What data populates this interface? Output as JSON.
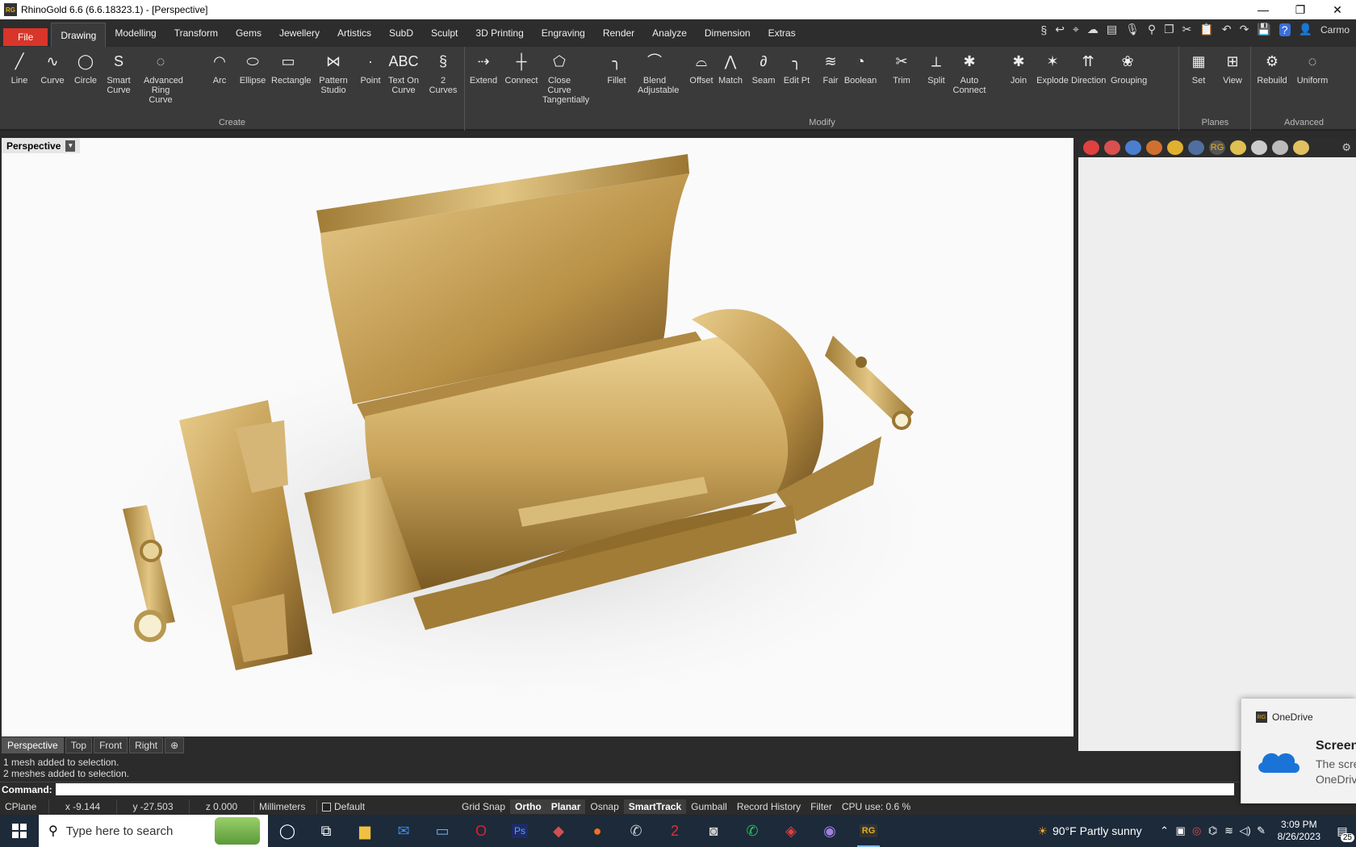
{
  "window": {
    "title": "RhinoGold 6.6 (6.6.18323.1) - [Perspective]",
    "logo": "RG",
    "min": "—",
    "max": "❐",
    "close": "✕"
  },
  "menu": [
    "File",
    "Drawing",
    "Modelling",
    "Transform",
    "Gems",
    "Jewellery",
    "Artistics",
    "SubD",
    "Sculpt",
    "3D Printing",
    "Engraving",
    "Render",
    "Analyze",
    "Dimension",
    "Extras"
  ],
  "quick": {
    "user": "Carmo"
  },
  "ribbon": {
    "create": {
      "label": "Create",
      "buttons": [
        {
          "name": "line",
          "label": "Line",
          "icon": "╱"
        },
        {
          "name": "curve",
          "label": "Curve",
          "icon": "∿"
        },
        {
          "name": "circle",
          "label": "Circle",
          "icon": "◯"
        },
        {
          "name": "smart-curve",
          "label": "Smart Curve",
          "icon": "S"
        },
        {
          "name": "advanced-ring-curve",
          "label": "Advanced Ring Curve",
          "icon": "◌"
        },
        {
          "name": "arc",
          "label": "Arc",
          "icon": "◠"
        },
        {
          "name": "ellipse",
          "label": "Ellipse",
          "icon": "⬭"
        },
        {
          "name": "rectangle",
          "label": "Rectangle",
          "icon": "▭"
        },
        {
          "name": "pattern-studio",
          "label": "Pattern Studio",
          "icon": "⋈"
        },
        {
          "name": "point",
          "label": "Point",
          "icon": "·"
        },
        {
          "name": "text-on-curve",
          "label": "Text On Curve",
          "icon": "ABC"
        },
        {
          "name": "2-curves",
          "label": "2 Curves",
          "icon": "§"
        }
      ]
    },
    "modify": {
      "label": "Modify",
      "buttons": [
        {
          "name": "extend",
          "label": "Extend",
          "icon": "⇢"
        },
        {
          "name": "connect",
          "label": "Connect",
          "icon": "┼"
        },
        {
          "name": "close-curve-tangentially",
          "label": "Close Curve Tangentially",
          "icon": "⬠"
        },
        {
          "name": "fillet",
          "label": "Fillet",
          "icon": "╮"
        },
        {
          "name": "blend-adjustable",
          "label": "Blend Adjustable",
          "icon": "⌒"
        },
        {
          "name": "offset",
          "label": "Offset",
          "icon": "⌓"
        },
        {
          "name": "match",
          "label": "Match",
          "icon": "⋀"
        },
        {
          "name": "seam",
          "label": "Seam",
          "icon": "∂"
        },
        {
          "name": "edit-pt",
          "label": "Edit Pt",
          "icon": "╮"
        },
        {
          "name": "fair",
          "label": "Fair",
          "icon": "≋"
        },
        {
          "name": "boolean",
          "label": "Boolean",
          "icon": "◔"
        },
        {
          "name": "trim",
          "label": "Trim",
          "icon": "✂"
        },
        {
          "name": "split",
          "label": "Split",
          "icon": "⟂"
        },
        {
          "name": "auto-connect",
          "label": "Auto Connect",
          "icon": "✱"
        },
        {
          "name": "join",
          "label": "Join",
          "icon": "✱"
        },
        {
          "name": "explode",
          "label": "Explode",
          "icon": "✶"
        },
        {
          "name": "direction",
          "label": "Direction",
          "icon": "⇈"
        },
        {
          "name": "grouping",
          "label": "Grouping",
          "icon": "❀"
        }
      ]
    },
    "planes": {
      "label": "Planes",
      "buttons": [
        {
          "name": "set",
          "label": "Set",
          "icon": "▦"
        },
        {
          "name": "view",
          "label": "View",
          "icon": "⊞"
        }
      ]
    },
    "advanced": {
      "label": "Advanced",
      "buttons": [
        {
          "name": "rebuild",
          "label": "Rebuild",
          "icon": "⚙"
        },
        {
          "name": "uniform",
          "label": "Uniform",
          "icon": "◌"
        }
      ]
    }
  },
  "viewport": {
    "label": "Perspective"
  },
  "view_tabs": [
    "Perspective",
    "Top",
    "Front",
    "Right"
  ],
  "history": [
    "1 mesh added to selection.",
    "2 meshes added to selection."
  ],
  "command": {
    "label": "Command:"
  },
  "status": {
    "cplane": "CPlane",
    "x": "x -9.144",
    "y": "y -27.503",
    "z": "z 0.000",
    "units": "Millimeters",
    "layer": "Default",
    "toggles": [
      {
        "label": "Grid Snap",
        "on": false
      },
      {
        "label": "Ortho",
        "on": true
      },
      {
        "label": "Planar",
        "on": true
      },
      {
        "label": "Osnap",
        "on": false
      },
      {
        "label": "SmartTrack",
        "on": true
      },
      {
        "label": "Gumball",
        "on": false
      },
      {
        "label": "Record History",
        "on": false
      },
      {
        "label": "Filter",
        "on": false
      }
    ],
    "cpu": "CPU use: 0.6 %"
  },
  "toast": {
    "app": "OneDrive",
    "heading": "Screens",
    "body1": "The scre",
    "body2": "OneDriv"
  },
  "taskbar": {
    "search_placeholder": "Type here to search",
    "weather": "90°F  Partly sunny",
    "time": "3:09 PM",
    "date": "8/26/2023",
    "notif_count": "25"
  },
  "colors": {
    "gold": "#c9a45a",
    "accent": "#d9352a"
  }
}
